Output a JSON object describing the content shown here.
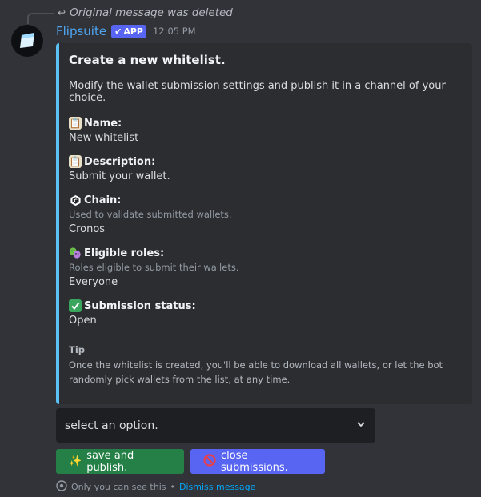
{
  "reply": {
    "text": "Original message was deleted",
    "icon": "reply-arrow-icon"
  },
  "author": {
    "name": "Flipsuite",
    "badge": "APP",
    "timestamp": "12:05 PM"
  },
  "embed": {
    "accent_color": "#5bc0f5",
    "title": "Create a new whitelist.",
    "description": "Modify the wallet submission settings and publish it in a channel of your choice.",
    "fields": [
      {
        "icon": "clipboard-icon",
        "name": "Name:",
        "hint": "",
        "value": "New whitelist"
      },
      {
        "icon": "clipboard-icon",
        "name": "Description:",
        "hint": "",
        "value": "Submit your wallet."
      },
      {
        "icon": "cronos-chain-icon",
        "name": "Chain:",
        "hint": "Used to validate submitted wallets.",
        "value": "Cronos"
      },
      {
        "icon": "performing-arts-icon",
        "name": "Eligible roles:",
        "hint": "Roles eligible to submit their wallets.",
        "value": "Everyone"
      },
      {
        "icon": "check-mark-icon",
        "name": "Submission status:",
        "hint": "",
        "value": "Open"
      }
    ],
    "tip_label": "Tip",
    "tip_text": "Once the whitelist is created, you'll be able to download all wallets, or let the bot randomly pick wallets from the list, at any time."
  },
  "select": {
    "placeholder": "select an option."
  },
  "buttons": [
    {
      "label": "save and publish.",
      "icon": "sparkles-icon",
      "color": "#248046"
    },
    {
      "label": "close submissions.",
      "icon": "prohibited-icon",
      "color": "#5865f2"
    }
  ],
  "ephemeral": {
    "text": "Only you can see this",
    "separator": "•",
    "dismiss": "Dismiss message"
  }
}
